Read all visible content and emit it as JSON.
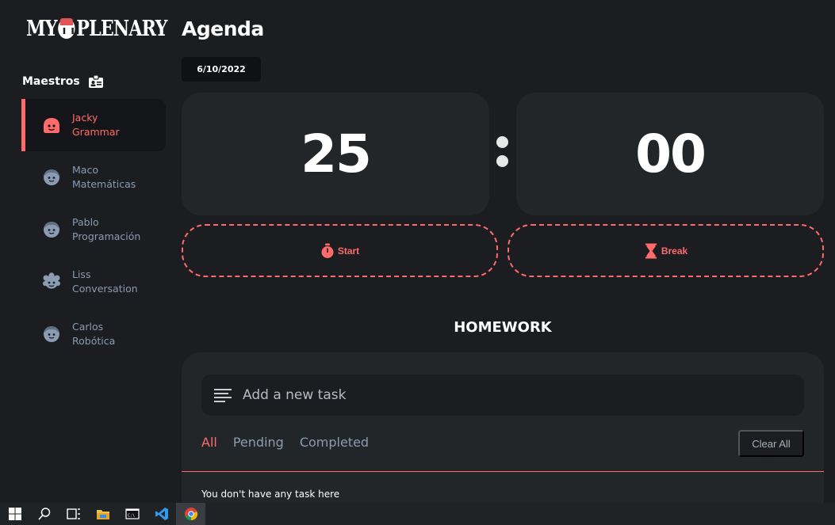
{
  "app": {
    "logo_text": "MY PLENARY",
    "logo_left": "MY",
    "logo_right": "PLENARY"
  },
  "sidebar": {
    "section_title": "Maestros",
    "section_icon": "id-badge-icon",
    "teachers": [
      {
        "first": "Jacky",
        "second": "Grammar",
        "active": true,
        "icon": "avatar-icon"
      },
      {
        "first": "Maco",
        "second": "Matemáticas",
        "active": false,
        "icon": "avatar-icon"
      },
      {
        "first": "Pablo",
        "second": "Programación",
        "active": false,
        "icon": "avatar-icon"
      },
      {
        "first": "Liss",
        "second": "Conversation",
        "active": false,
        "icon": "avatar-curly-icon"
      },
      {
        "first": "Carlos",
        "second": "Robótica",
        "active": false,
        "icon": "avatar-icon"
      }
    ]
  },
  "main": {
    "title": "Agenda",
    "date": "6/10/2022",
    "timer": {
      "minutes": "25",
      "seconds": "00"
    },
    "start_label": "Start",
    "break_label": "Break"
  },
  "homework": {
    "title": "HOMEWORK",
    "input_placeholder": "Add a new task",
    "filters": [
      "All",
      "Pending",
      "Completed"
    ],
    "active_filter": "All",
    "clear_label": "Clear All",
    "empty_message": "You don't have any task here"
  },
  "taskbar": {
    "items": [
      "windows-start-icon",
      "search-icon",
      "task-view-icon",
      "file-explorer-icon",
      "terminal-icon",
      "vscode-icon",
      "chrome-icon"
    ],
    "active": "chrome-icon"
  },
  "colors": {
    "accent": "#ff6b6b",
    "background": "#1b1d21",
    "card": "#232629",
    "muted": "#8a9bb2"
  }
}
